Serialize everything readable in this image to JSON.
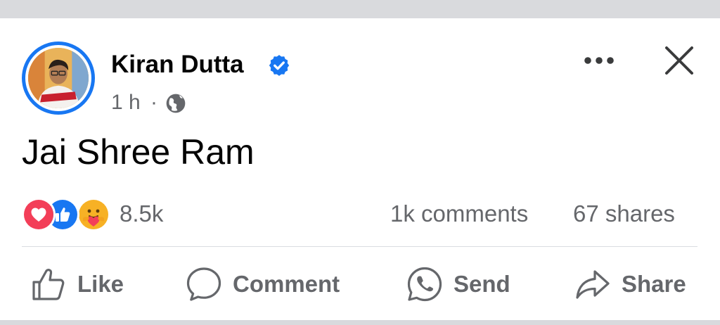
{
  "post": {
    "author": {
      "name": "Kiran Dutta",
      "verified": true,
      "avatar": "profile-photo"
    },
    "time": "1 h",
    "separator": "·",
    "audience_icon": "globe-icon",
    "text": "Jai Shree Ram",
    "reactions": {
      "types": [
        "love",
        "like",
        "care"
      ],
      "count": "8.5k"
    },
    "comments": "1k comments",
    "shares": "67 shares"
  },
  "actions": {
    "like": "Like",
    "comment": "Comment",
    "send": "Send",
    "share": "Share"
  },
  "colors": {
    "accent": "#1877f2",
    "secondary_text": "#65676b",
    "love": "#f33e58",
    "care": "#f7b125"
  }
}
